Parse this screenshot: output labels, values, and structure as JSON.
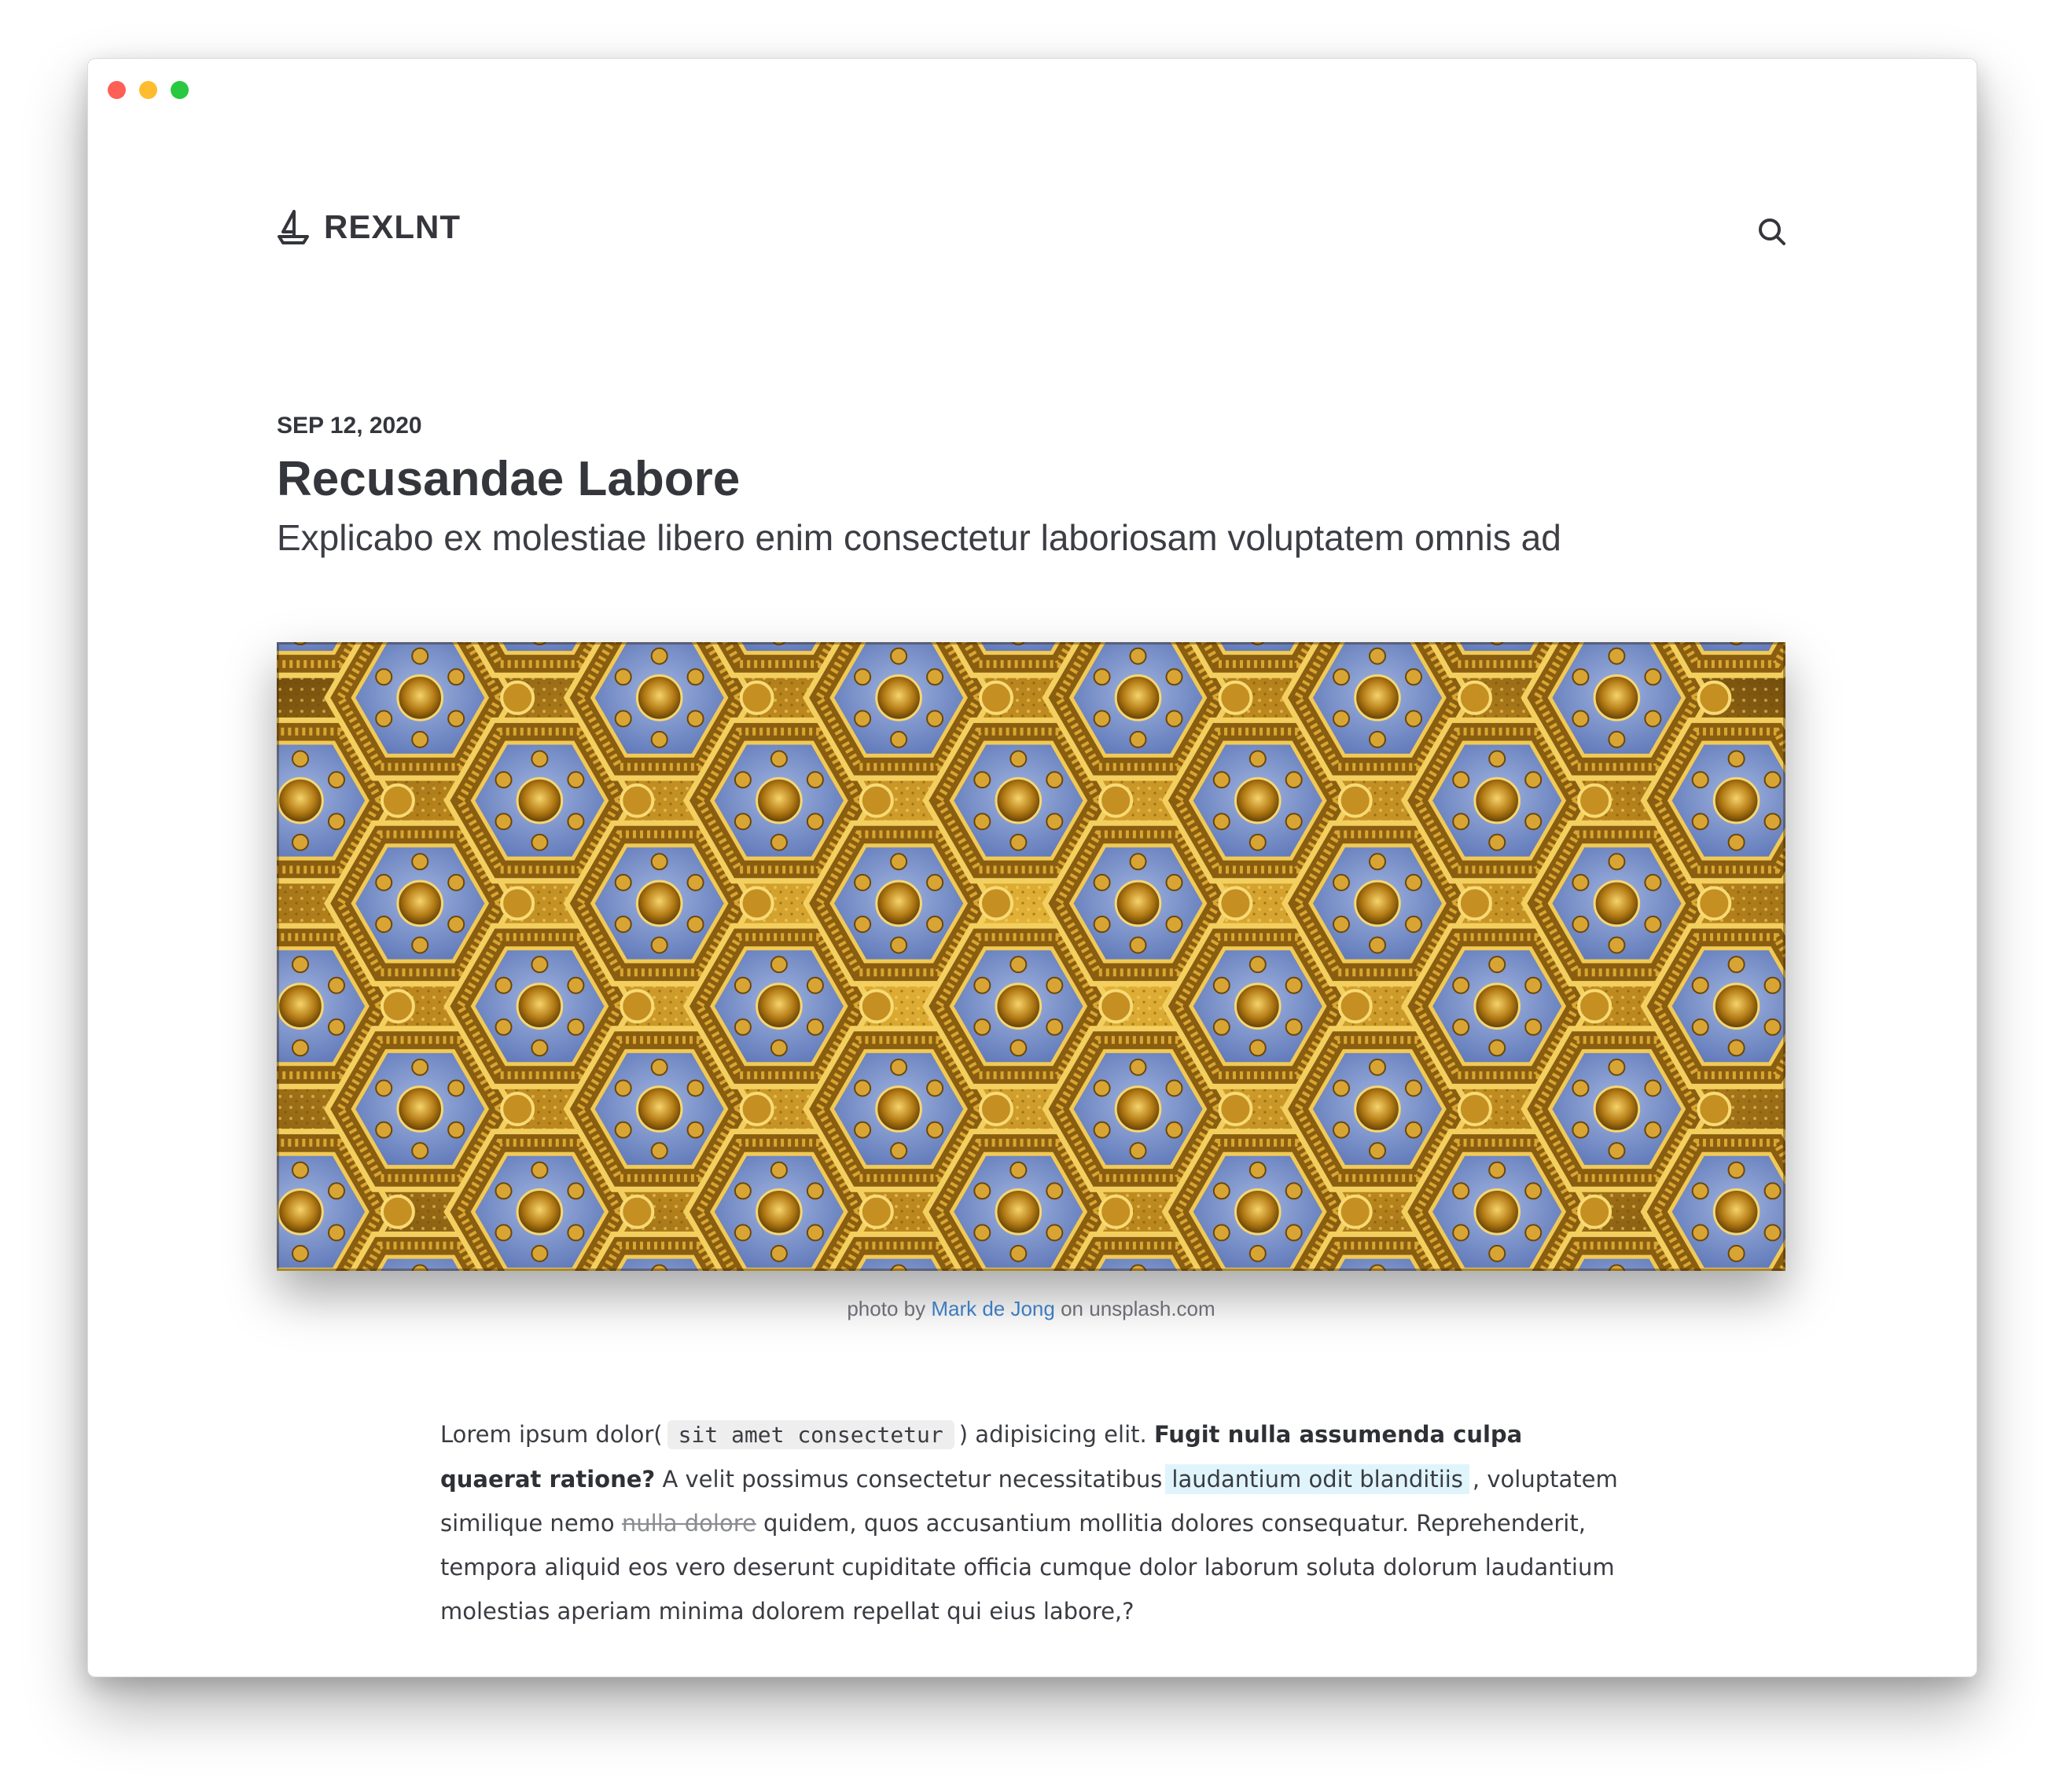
{
  "colors": {
    "text_dark": "#34363c",
    "link_blue": "#3b7bc0",
    "highlight_bg": "#e0f4fb",
    "code_bg": "#eeeeee",
    "traffic_red": "#fe5f57",
    "traffic_yellow": "#febc2e",
    "traffic_green": "#28c840"
  },
  "window": {
    "controls": [
      "close",
      "minimize",
      "maximize"
    ]
  },
  "header": {
    "logo_icon": "sailboat-icon",
    "logo_text": "REXLNT",
    "search_icon": "search-icon"
  },
  "post": {
    "date": "SEP 12, 2020",
    "title": "Recusandae Labore",
    "subtitle": "Explicabo ex molestiae libero enim consectetur laboriosam voluptatem omnis ad",
    "image_alt": "ornate gilded ceiling with blue hexagonal coffers",
    "caption": {
      "prefix": "photo by",
      "author": "Mark de Jong",
      "suffix": "on unsplash.com"
    }
  },
  "body": {
    "p1_a": "Lorem ipsum dolor(",
    "p1_code": "sit amet consectetur",
    "p1_b": ") adipisicing elit.",
    "p1_bold": "Fugit nulla assumenda culpa quaerat ratione?",
    "p1_c": "A velit possimus consectetur necessitatibus",
    "p1_highlight": "laudantium odit blanditiis",
    "p1_d": ", voluptatem similique nemo",
    "p1_strike": "nulla dolore",
    "p1_e": "quidem, quos accusantium mollitia dolores consequatur. Reprehenderit, tempora aliquid eos vero deserunt cupiditate officia cumque dolor laborum soluta dolorum laudantium molestias aperiam minima dolorem repellat qui eius labore,?"
  }
}
